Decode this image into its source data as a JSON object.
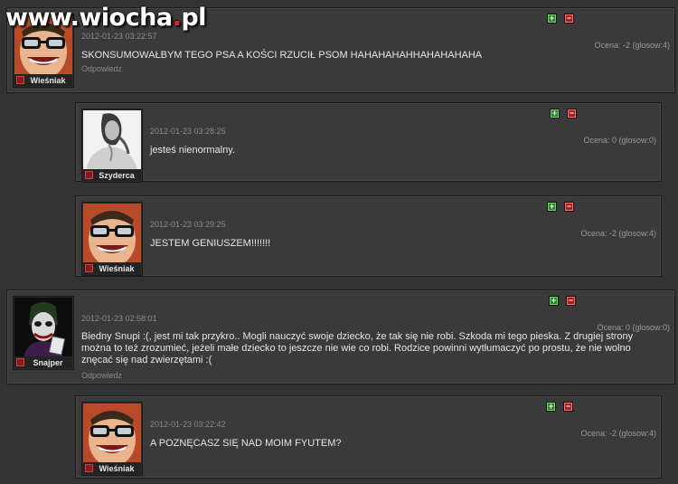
{
  "watermark": {
    "site": "www.wiocha",
    "dot": ".",
    "tld": "pl"
  },
  "colors": {
    "vote_plus": "#2a8a2a",
    "vote_minus": "#a61f1f",
    "background": "#333333",
    "panel": "#3a3a3a"
  },
  "comments": [
    {
      "author": "Wieśniak",
      "timestamp": "2012-01-23 03:22:57",
      "rating": "Ocena: -2 (glosow:4)",
      "text": "SKONSUMOWAŁBYM TEGO PSA A KOŚCI RZUCIŁ PSOM HAHAHAHAHHAHAHAHAHA",
      "reply": "Odpowiedz",
      "avatar": "grinning-man-glasses"
    },
    {
      "author": "Szyderca",
      "timestamp": "2012-01-23 03:28:25",
      "rating": "Ocena: 0 (glosow:0)",
      "text": "jesteś nienormalny.",
      "avatar": "woman-bw-photo"
    },
    {
      "author": "Wieśniak",
      "timestamp": "2012-01-23 03:29:25",
      "rating": "Ocena: -2 (glosow:4)",
      "text": "JESTEM GENIUSZEM!!!!!!!",
      "avatar": "grinning-man-glasses"
    },
    {
      "author": "Snajper",
      "timestamp": "2012-01-23 02:58:01",
      "rating": "Ocena: 0 (glosow:0)",
      "text_lines": [
        "Biedny Snupi :(, jest mi tak przykro.. Mogli nauczyć swoje dziecko, że tak się nie robi. Szkoda mi tego pieska. Z drugiej strony",
        "można to też zrozumieć, jeżeli małe dziecko to jeszcze nie wie co robi. Rodzice powinni wytłumaczyć po prostu, że nie wolno",
        "znęcać się nad zwierzętami :("
      ],
      "reply": "Odpowiedz",
      "avatar": "joker-card"
    },
    {
      "author": "Wieśniak",
      "timestamp": "2012-01-23 03:22:42",
      "rating": "Ocena: -2 (glosow:4)",
      "text": "A POZNĘCASZ SIĘ NAD MOIM FYUTEM?",
      "avatar": "grinning-man-glasses"
    }
  ]
}
